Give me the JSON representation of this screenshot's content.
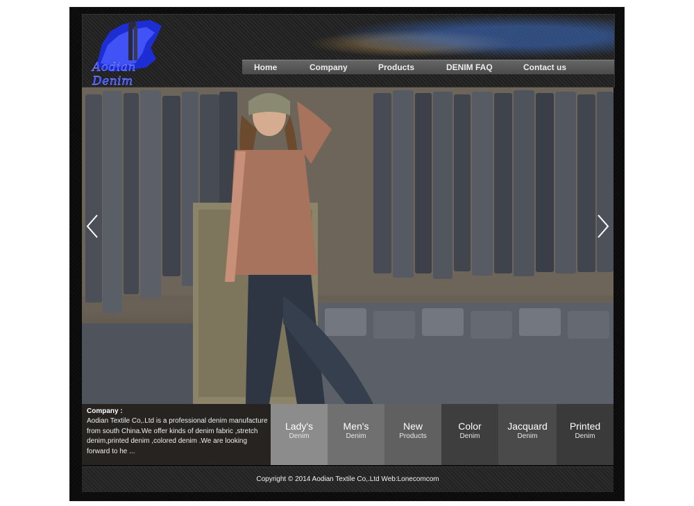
{
  "logo": {
    "text": "Aodian Denim"
  },
  "nav": {
    "items": [
      "Home",
      "Company",
      "Products",
      "DENIM FAQ",
      "Contact us"
    ]
  },
  "hero": {
    "prev_icon": "chevron-left-icon",
    "next_icon": "chevron-right-icon"
  },
  "company": {
    "title": "Company :",
    "description": "Aodian Textile Co,.Ltd is a professional denim manufacture from south China.We offer kinds of denim fabric ,stretch denim,printed denim ,colored denim .We are looking forward to he ..."
  },
  "categories": [
    {
      "title": "Lady's",
      "subtitle": "Denim"
    },
    {
      "title": "Men's",
      "subtitle": "Denim"
    },
    {
      "title": "New",
      "subtitle": "Products"
    },
    {
      "title": "Color",
      "subtitle": "Denim"
    },
    {
      "title": "Jacquard",
      "subtitle": "Denim"
    },
    {
      "title": "Printed",
      "subtitle": "Denim"
    }
  ],
  "footer": {
    "copyright": "Copyright © 2014 Aodian Textile Co,.Ltd Web:Lonecomcom"
  },
  "colors": {
    "nav_bar": "#5a5a5a",
    "tile_light": "#8c8c8c",
    "tile_dark": "#3c3c3c",
    "logo_blue": "#2b3dff"
  }
}
